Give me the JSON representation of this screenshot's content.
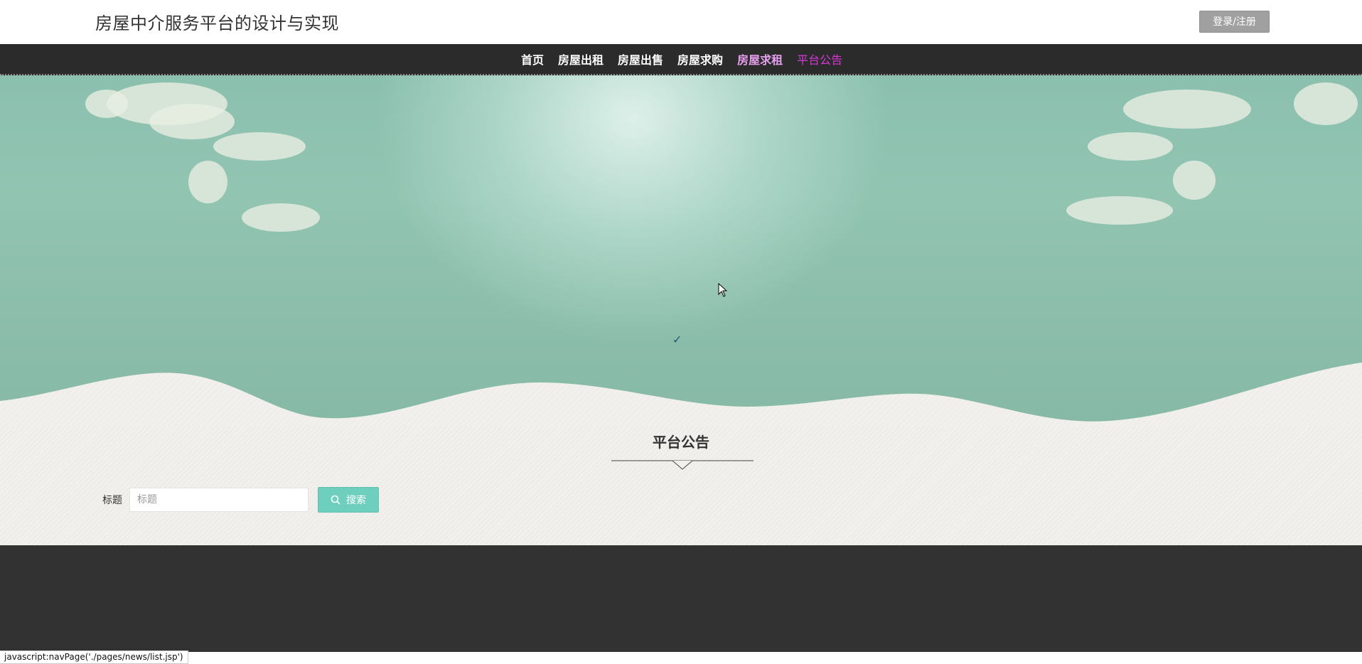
{
  "header": {
    "site_title": "房屋中介服务平台的设计与实现",
    "login_label": "登录/注册"
  },
  "nav": {
    "items": [
      {
        "label": "首页",
        "state": "normal"
      },
      {
        "label": "房屋出租",
        "state": "normal"
      },
      {
        "label": "房屋出售",
        "state": "normal"
      },
      {
        "label": "房屋求购",
        "state": "normal"
      },
      {
        "label": "房屋求租",
        "state": "hover"
      },
      {
        "label": "平台公告",
        "state": "active"
      }
    ],
    "colors": {
      "normal": "#ffffff",
      "hover": "#e6a0ee",
      "active": "#d838d8"
    }
  },
  "section": {
    "title": "平台公告"
  },
  "search": {
    "label": "标题",
    "placeholder": "标题",
    "value": "",
    "button_label": "搜索",
    "button_icon": "search-icon"
  },
  "status_bar": {
    "text": "javascript:navPage('./pages/news/list.jsp')"
  },
  "colors": {
    "nav_bg": "#2b2b2b",
    "accent": "#6fcfbf",
    "footer_bg": "#323232",
    "login_button_bg": "#a0a0a0"
  }
}
